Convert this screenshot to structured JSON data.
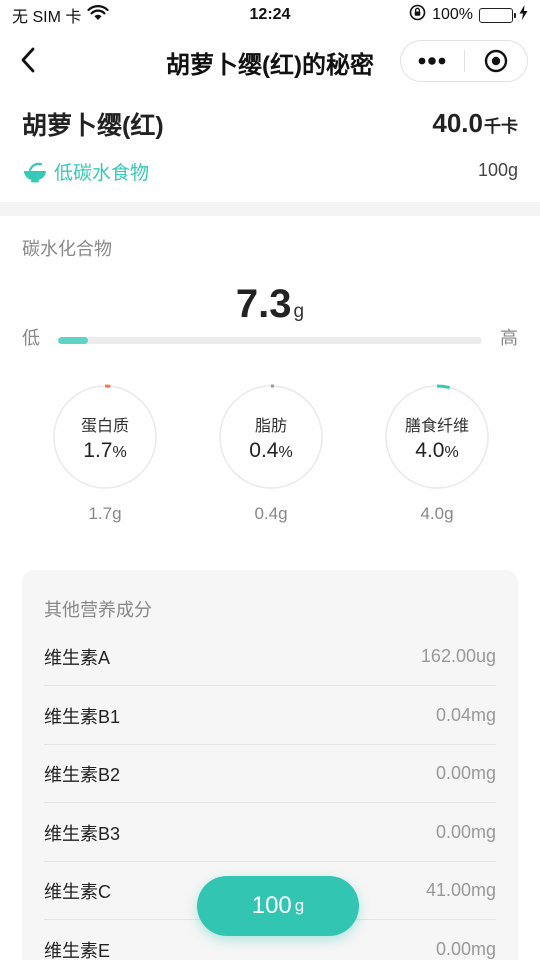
{
  "status_bar": {
    "carrier": "无 SIM 卡",
    "time": "12:24",
    "battery_percent": "100%",
    "battery_level": 1.0
  },
  "nav": {
    "title": "胡萝卜缨(红)的秘密"
  },
  "food": {
    "name": "胡萝卜缨(红)",
    "calories": "40.0",
    "calories_unit": "千卡",
    "tag": "低碳水食物",
    "weight": "100g"
  },
  "carb": {
    "title": "碳水化合物",
    "value": "7.3",
    "unit": "g",
    "low_label": "低",
    "high_label": "高",
    "level": 0.07
  },
  "macros": [
    {
      "label": "蛋白质",
      "percent": "1.7",
      "percent_sign": "%",
      "grams": "1.7g",
      "fraction": 0.017,
      "color": "#f07b4f"
    },
    {
      "label": "脂肪",
      "percent": "0.4",
      "percent_sign": "%",
      "grams": "0.4g",
      "fraction": 0.004,
      "color": "#999999"
    },
    {
      "label": "膳食纤维",
      "percent": "4.0",
      "percent_sign": "%",
      "grams": "4.0g",
      "fraction": 0.04,
      "color": "#37c9b8"
    }
  ],
  "other_nutrients": {
    "title": "其他营养成分",
    "items": [
      {
        "name": "维生素A",
        "value": "162.00ug"
      },
      {
        "name": "维生素B1",
        "value": "0.04mg"
      },
      {
        "name": "维生素B2",
        "value": "0.00mg"
      },
      {
        "name": "维生素B3",
        "value": "0.00mg"
      },
      {
        "name": "维生素C",
        "value": "41.00mg"
      },
      {
        "name": "维生素E",
        "value": "0.00mg"
      }
    ]
  },
  "float_button": {
    "value": "100",
    "unit": "g"
  },
  "colors": {
    "accent": "#37c9b8",
    "button": "#32c6b2"
  }
}
